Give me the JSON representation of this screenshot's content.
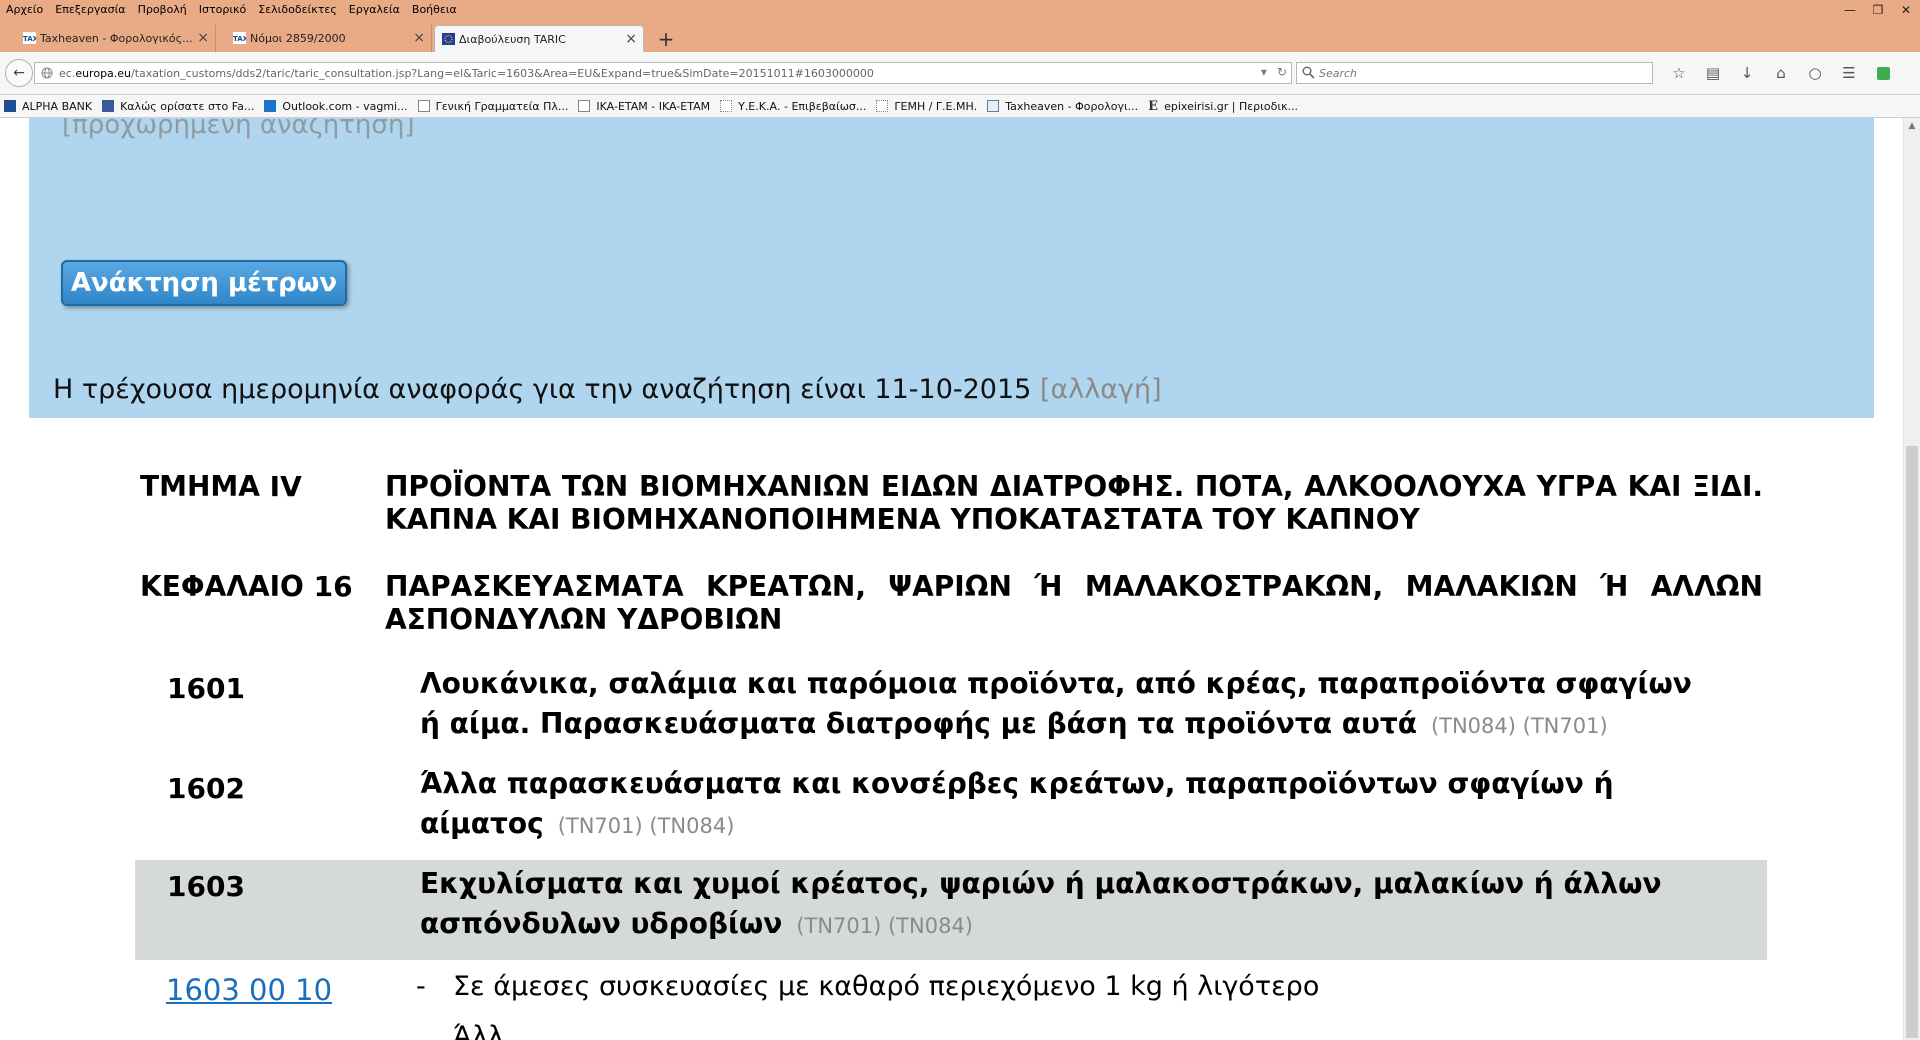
{
  "menu": [
    "Αρχείο",
    "Επεξεργασία",
    "Προβολή",
    "Ιστορικό",
    "Σελιδοδείκτες",
    "Εργαλεία",
    "Βοήθεια"
  ],
  "tabs": [
    {
      "label": "Taxheaven - Φορολογικός..."
    },
    {
      "label": "Νόμοι 2859/2000"
    },
    {
      "label": "Διαβούλευση TARIC"
    }
  ],
  "url": {
    "prefix": "ec.",
    "domain": "europa.eu",
    "rest": "/taxation_customs/dds2/taric/taric_consultation.jsp?Lang=el&Taric=1603&Area=EU&Expand=true&SimDate=20151011#1603000000"
  },
  "search": {
    "placeholder": "Search"
  },
  "bookmarks": [
    {
      "label": "ALPHA BANK"
    },
    {
      "label": "Καλώς ορίσατε στο Fa..."
    },
    {
      "label": "Outlook.com - vagmi..."
    },
    {
      "label": "Γενική Γραμματεία Πλ..."
    },
    {
      "label": "IKA-ETAM - IKA-ETAM"
    },
    {
      "label": "Υ.Ε.Κ.Α. - Επιβεβαίωσ..."
    },
    {
      "label": "ΓΕΜΗ / Γ.Ε.ΜΗ."
    },
    {
      "label": "Taxheaven - Φορολογι..."
    },
    {
      "label": "epixeirisi.gr | Περιοδικ..."
    }
  ],
  "panel": {
    "advanced_search": "[προχωρημένη αναζήτηση]",
    "retrieve_button": "Ανάκτηση μέτρων",
    "ref_date_text": "Η τρέχουσα ημερομηνία αναφοράς για την αναζήτηση είναι 11-10-2015",
    "change_link": "[αλλαγή]"
  },
  "section": {
    "label": "ΤΜΗΜΑ IV",
    "title": "ΠΡΟΪΟΝΤΑ ΤΩΝ ΒΙΟΜΗΧΑΝΙΩΝ ΕΙΔΩΝ ΔΙΑΤΡΟΦΗΣ. ΠΟΤΑ, ΑΛΚΟΟΛΟΥΧΑ ΥΓΡΑ ΚΑΙ ΞΙΔΙ. ΚΑΠΝΑ ΚΑΙ ΒΙΟΜΗΧΑΝΟΠΟΙΗΜΕΝΑ ΥΠΟΚΑΤΑΣΤΑΤΑ ΤΟΥ ΚΑΠΝΟΥ"
  },
  "chapter": {
    "label": "ΚΕΦΑΛΑΙΟ 16",
    "title": "ΠΑΡΑΣΚΕΥΑΣΜΑΤΑ ΚΡΕΑΤΩΝ, ΨΑΡΙΩΝ Ή ΜΑΛΑΚΟΣΤΡΑΚΩΝ, ΜΑΛΑΚΙΩΝ Ή ΑΛΛΩΝ ΑΣΠΟΝΔΥΛΩΝ ΥΔΡΟΒΙΩΝ"
  },
  "headings": [
    {
      "code": "1601",
      "text": "Λουκάνικα, σαλάμια και παρόμοια προϊόντα, από κρέας, παραπροϊόντα σφαγίων ή αίμα. Παρασκευάσματα διατροφής με βάση τα προϊόντα αυτά",
      "notes": "(TN084) (TN701)"
    },
    {
      "code": "1602",
      "text": "Άλλα παρασκευάσματα και κονσέρβες κρεάτων, παραπροϊόντων σφαγίων ή αίματος",
      "notes": "(TN701) (TN084)"
    },
    {
      "code": "1603",
      "text": "Εκχυλίσματα και χυμοί κρέατος, ψαριών ή μαλακοστράκων, μαλακίων ή άλλων ασπόνδυλων υδροβίων",
      "notes": "(TN701) (TN084)"
    }
  ],
  "subheading": {
    "code": "1603 00 10",
    "dash": "-",
    "text": "Σε άμεσες συσκευασίες με καθαρό περιεχόμενο 1 kg ή λιγότερο"
  },
  "next_partial": "Άλλ"
}
